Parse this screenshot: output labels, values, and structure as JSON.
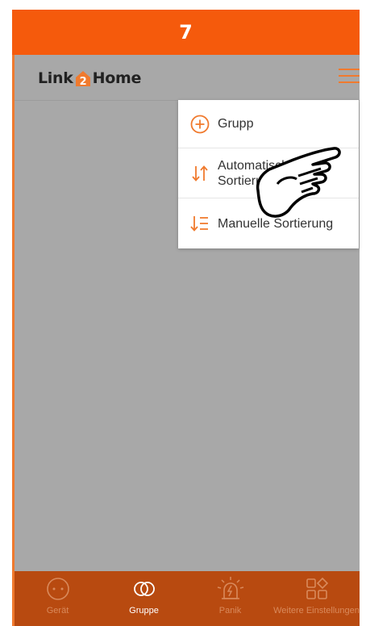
{
  "step_banner": {
    "number": "7"
  },
  "header": {
    "logo": {
      "text_left": "Link",
      "text_mark": "2",
      "text_right": "Home"
    },
    "menu_icon": "hamburger-menu-icon"
  },
  "dropdown": {
    "items": [
      {
        "icon": "plus-circle-icon",
        "label": "Grupp"
      },
      {
        "icon": "auto-sort-arrows-icon",
        "label": "Automatische Sortierung"
      },
      {
        "icon": "manual-sort-icon",
        "label": "Manuelle Sortierung"
      }
    ]
  },
  "cursor": {
    "icon": "pointing-hand-icon"
  },
  "tabbar": {
    "tabs": [
      {
        "icon": "device-icon",
        "label": "Gerät",
        "active": false
      },
      {
        "icon": "group-rings-icon",
        "label": "Gruppe",
        "active": true
      },
      {
        "icon": "panic-siren-icon",
        "label": "Panik",
        "active": false
      },
      {
        "icon": "more-settings-grid-icon",
        "label": "Weitere Einstellungen",
        "active": false
      }
    ]
  },
  "colors": {
    "accent": "#f55a0c",
    "tabbar": "#b84a10",
    "overlay_gray": "#a8a8a8",
    "menu_icon": "#f07a2e"
  }
}
